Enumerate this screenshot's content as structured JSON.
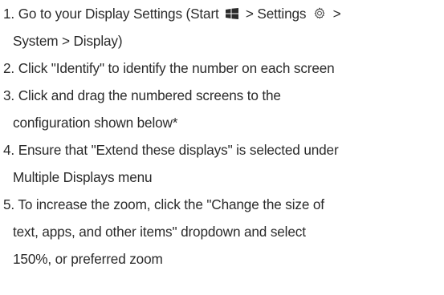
{
  "steps": [
    {
      "number": "1.",
      "text_a": "Go to your Display Settings (Start",
      "icon_a": "windows-logo-icon",
      "text_b": "> Settings",
      "icon_b": "gear-icon",
      "text_c": ">",
      "text_d": "System > Display)"
    },
    {
      "number": "2.",
      "text": "Click \"Identify\" to identify the number on each screen"
    },
    {
      "number": "3.",
      "text": "Click and drag the numbered screens to the",
      "text_2": "configuration shown below*"
    },
    {
      "number": "4.",
      "text": "Ensure that \"Extend these displays\" is selected under",
      "text_2": "Multiple Displays menu"
    },
    {
      "number": "5.",
      "text": "To increase the zoom, click the \"Change the size of",
      "text_2": "text, apps, and other items\" dropdown and select",
      "text_3": "150%, or preferred zoom"
    }
  ]
}
